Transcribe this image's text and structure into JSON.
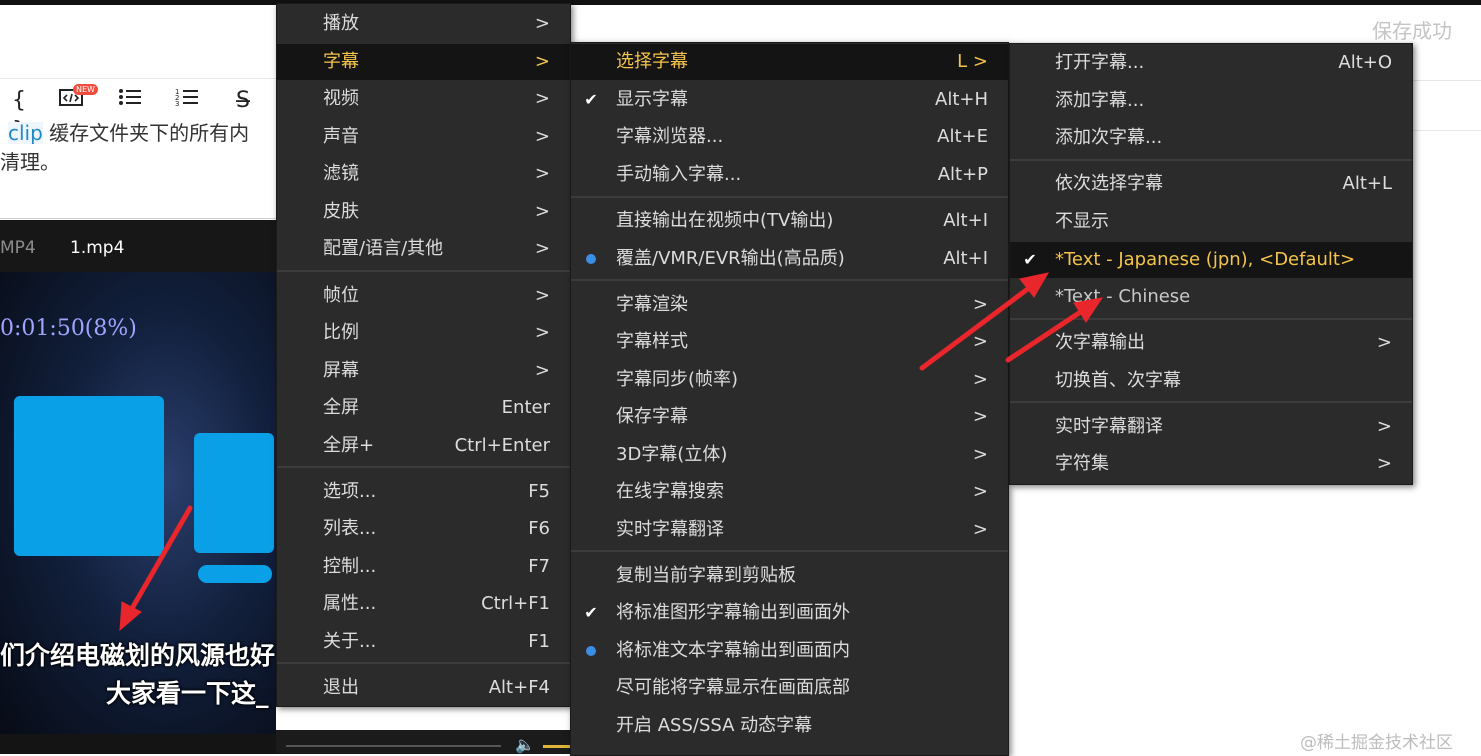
{
  "status": {
    "save_text": "保存成功"
  },
  "editor": {
    "new_badge": "NEW",
    "line1_code": "clip",
    "line1_text": " 缓存文件夹下的所有内",
    "line2_text": "清理。"
  },
  "player": {
    "tabs": [
      "MP4",
      "1.mp4"
    ],
    "time_display": "0:01:50(8%)",
    "subtitle_line1": "们介绍电磁划的风源也好",
    "subtitle_line2": "大家看一下这_"
  },
  "menu_main": {
    "items": [
      {
        "label": "播放",
        "shortcut": ">"
      },
      {
        "label": "字幕",
        "shortcut": ">"
      },
      {
        "label": "视频",
        "shortcut": ">"
      },
      {
        "label": "声音",
        "shortcut": ">"
      },
      {
        "label": "滤镜",
        "shortcut": ">"
      },
      {
        "label": "皮肤",
        "shortcut": ">"
      },
      {
        "label": "配置/语言/其他",
        "shortcut": ">"
      },
      {
        "label": "帧位",
        "shortcut": ">"
      },
      {
        "label": "比例",
        "shortcut": ">"
      },
      {
        "label": "屏幕",
        "shortcut": ">"
      },
      {
        "label": "全屏",
        "shortcut": "Enter"
      },
      {
        "label": "全屏+",
        "shortcut": "Ctrl+Enter"
      },
      {
        "label": "选项...",
        "shortcut": "F5"
      },
      {
        "label": "列表...",
        "shortcut": "F6"
      },
      {
        "label": "控制...",
        "shortcut": "F7"
      },
      {
        "label": "属性...",
        "shortcut": "Ctrl+F1"
      },
      {
        "label": "关于...",
        "shortcut": "F1"
      },
      {
        "label": "退出",
        "shortcut": "Alt+F4"
      }
    ]
  },
  "menu_subtitle": {
    "items": [
      {
        "label": "选择字幕",
        "shortcut": "L >"
      },
      {
        "label": "显示字幕",
        "shortcut": "Alt+H"
      },
      {
        "label": "字幕浏览器...",
        "shortcut": "Alt+E"
      },
      {
        "label": "手动输入字幕...",
        "shortcut": "Alt+P"
      },
      {
        "label": "直接输出在视频中(TV输出)",
        "shortcut": "Alt+I"
      },
      {
        "label": "覆盖/VMR/EVR输出(高品质)",
        "shortcut": "Alt+I"
      },
      {
        "label": "字幕渲染",
        "shortcut": ">"
      },
      {
        "label": "字幕样式",
        "shortcut": ">"
      },
      {
        "label": "字幕同步(帧率)",
        "shortcut": ">"
      },
      {
        "label": "保存字幕",
        "shortcut": ">"
      },
      {
        "label": "3D字幕(立体)",
        "shortcut": ">"
      },
      {
        "label": "在线字幕搜索",
        "shortcut": ">"
      },
      {
        "label": "实时字幕翻译",
        "shortcut": ">"
      },
      {
        "label": "复制当前字幕到剪贴板",
        "shortcut": ""
      },
      {
        "label": "将标准图形字幕输出到画面外",
        "shortcut": ""
      },
      {
        "label": "将标准文本字幕输出到画面内",
        "shortcut": ""
      },
      {
        "label": "尽可能将字幕显示在画面底部",
        "shortcut": ""
      },
      {
        "label": "开启 ASS/SSA 动态字幕",
        "shortcut": ""
      }
    ]
  },
  "menu_select": {
    "items": [
      {
        "label": "打开字幕...",
        "shortcut": "Alt+O"
      },
      {
        "label": "添加字幕...",
        "shortcut": ""
      },
      {
        "label": "添加次字幕...",
        "shortcut": ""
      },
      {
        "label": "依次选择字幕",
        "shortcut": "Alt+L"
      },
      {
        "label": "不显示",
        "shortcut": ""
      },
      {
        "label": "*Text - Japanese (jpn), <Default>",
        "shortcut": ""
      },
      {
        "label": "*Text - Chinese",
        "shortcut": ""
      },
      {
        "label": "次字幕输出",
        "shortcut": ">"
      },
      {
        "label": "切换首、次字幕",
        "shortcut": ""
      },
      {
        "label": "实时字幕翻译",
        "shortcut": ">"
      },
      {
        "label": "字符集",
        "shortcut": ">"
      }
    ]
  },
  "watermark": "@稀土掘金技术社区",
  "colors": {
    "highlight_text": "#f4c44a",
    "annotation_arrow": "#e8262b",
    "video_block": "#0aa0e8"
  }
}
